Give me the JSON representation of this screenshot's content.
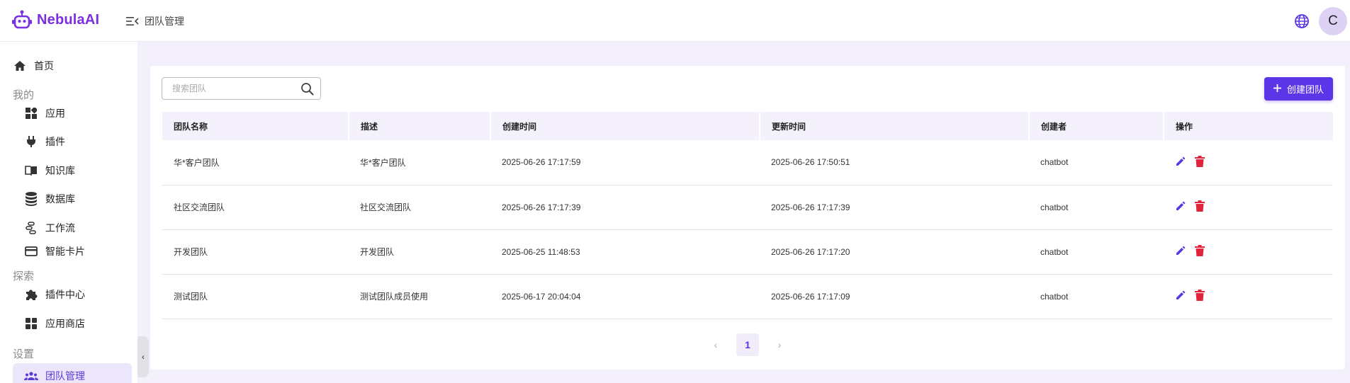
{
  "brand": {
    "name": "NebulaAI",
    "color": "#7b2fe0"
  },
  "header": {
    "breadcrumb": "团队管理",
    "menu_icon": "menu-collapse-icon",
    "lang_icon": "globe-icon",
    "avatar_letter": "C"
  },
  "sidebar": {
    "home": "首页",
    "groups": [
      {
        "title": "我的",
        "items": [
          "应用",
          "插件",
          "知识库",
          "数据库",
          "工作流",
          "智能卡片"
        ]
      },
      {
        "title": "探索",
        "items": [
          "插件中心",
          "应用商店"
        ]
      },
      {
        "title": "设置",
        "items": [
          "团队管理"
        ]
      }
    ],
    "active": "团队管理"
  },
  "toolbar": {
    "search_placeholder": "搜索团队",
    "create_label": "创建团队"
  },
  "table": {
    "columns": [
      "团队名称",
      "描述",
      "创建时间",
      "更新时间",
      "创建者",
      "操作"
    ],
    "rows": [
      [
        "华*客户团队",
        "华*客户团队",
        "2025-06-26 17:17:59",
        "2025-06-26 17:50:51",
        "chatbot"
      ],
      [
        "社区交流团队",
        "社区交流团队",
        "2025-06-26 17:17:39",
        "2025-06-26 17:17:39",
        "chatbot"
      ],
      [
        "开发团队",
        "开发团队",
        "2025-06-25 11:48:53",
        "2025-06-26 17:17:20",
        "chatbot"
      ],
      [
        "测试团队",
        "测试团队成员使用",
        "2025-06-17 20:04:04",
        "2025-06-26 17:17:09",
        "chatbot"
      ]
    ]
  },
  "pagination": {
    "current": "1"
  },
  "colors": {
    "accent": "#5b35e8",
    "delete": "#e0243c",
    "edit": "#5b35e8"
  }
}
